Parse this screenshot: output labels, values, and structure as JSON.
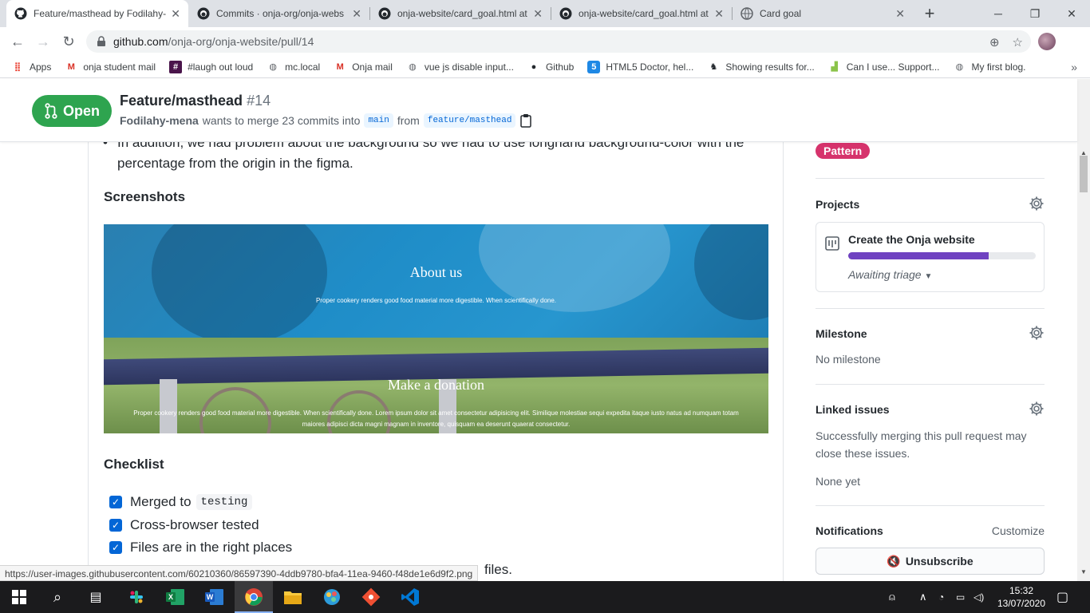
{
  "browser": {
    "tabs": [
      {
        "title": "Feature/masthead by Fodilahy-",
        "active": true
      },
      {
        "title": "Commits · onja-org/onja-webs",
        "active": false
      },
      {
        "title": "onja-website/card_goal.html at",
        "active": false
      },
      {
        "title": "onja-website/card_goal.html at",
        "active": false
      },
      {
        "title": "Card goal",
        "active": false
      }
    ],
    "url_host": "github.com",
    "url_path": "/onja-org/onja-website/pull/14",
    "bookmarks": [
      {
        "label": "Apps",
        "icon": "apps-grid-icon"
      },
      {
        "label": "onja student mail",
        "icon": "gmail-icon"
      },
      {
        "label": "#laugh out loud",
        "icon": "slack-icon"
      },
      {
        "label": "mc.local",
        "icon": "globe-icon"
      },
      {
        "label": "Onja mail",
        "icon": "gmail-icon"
      },
      {
        "label": "vue js disable input...",
        "icon": "globe-icon"
      },
      {
        "label": "Github",
        "icon": "github-icon"
      },
      {
        "label": "HTML5 Doctor, hel...",
        "icon": "html5doctor-icon"
      },
      {
        "label": "Showing results for...",
        "icon": "badge-icon"
      },
      {
        "label": "Can I use... Support...",
        "icon": "caniuse-icon"
      },
      {
        "label": "My first blog.",
        "icon": "globe-icon"
      }
    ]
  },
  "pr": {
    "state": "Open",
    "title": "Feature/masthead",
    "number": "#14",
    "author": "Fodilahy-mena",
    "merge_text": "wants to merge 23 commits into",
    "base": "main",
    "from_text": "from",
    "head": "feature/masthead"
  },
  "body": {
    "prev_paragraph": "In addition, we had problem about the background so we had to use longhand background-color with the percentage from the origin in the figma.",
    "screenshots_heading": "Screenshots",
    "shot": {
      "top_title": "About us",
      "top_text": "Proper cookery renders good food material more digestible. When scientifically done.",
      "bottom_title": "Make a donation",
      "bottom_text": "Proper cookery renders good food material more digestible. When scientifically done. Lorem ipsum dolor sit amet consectetur adipisicing elit. Similique molestiae sequi expedita itaque iusto natus ad numquam totam maiores adipisci dicta magni magnam in inventore, quisquam ea deserunt quaerat consectetur."
    },
    "checklist_heading": "Checklist",
    "checklist": [
      {
        "text": "Merged to",
        "code": "testing",
        "checked": true
      },
      {
        "text": "Cross-browser tested",
        "code": "",
        "checked": true
      },
      {
        "text": "Files are in the right places",
        "code": "",
        "checked": true
      }
    ],
    "partial_tail": "files."
  },
  "sidebar": {
    "label": "Pattern",
    "label_color": "#d6336c",
    "projects_heading": "Projects",
    "project_name": "Create the Onja website",
    "project_progress": 0.75,
    "project_status": "Awaiting triage",
    "milestone_heading": "Milestone",
    "milestone_value": "No milestone",
    "linked_heading": "Linked issues",
    "linked_text": "Successfully merging this pull request may close these issues.",
    "linked_value": "None yet",
    "notifications_heading": "Notifications",
    "customize": "Customize",
    "unsubscribe": "Unsubscribe"
  },
  "status_url": "https://user-images.githubusercontent.com/60210360/86597390-4ddb9780-bfa4-11ea-9460-f48de1e6d9f2.png",
  "taskbar": {
    "time": "15:32",
    "date": "13/07/2020"
  },
  "colors": {
    "open_green": "#2ea44f",
    "link_blue": "#0366d6",
    "progress_purple": "#6f42c1"
  }
}
